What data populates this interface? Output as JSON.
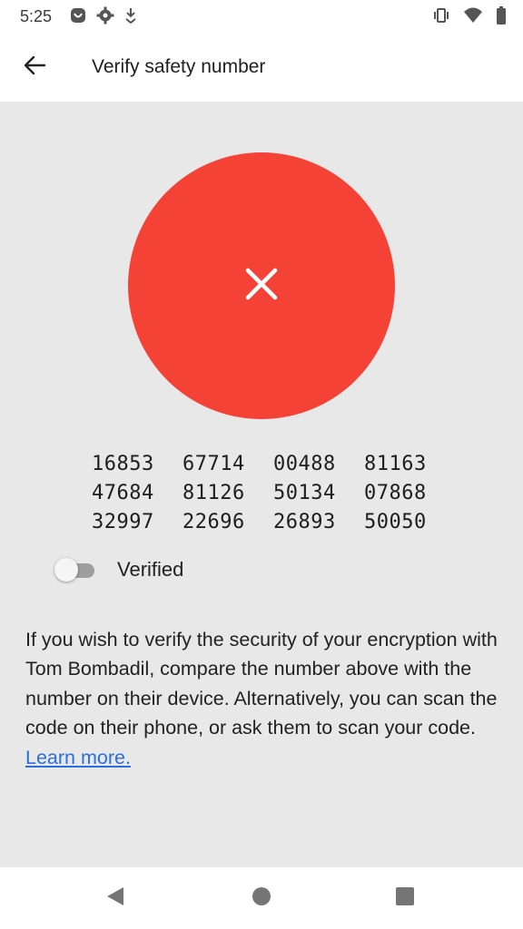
{
  "status_bar": {
    "time": "5:25",
    "left_icons": [
      "app-notification-icon",
      "gear-icon",
      "download-icon"
    ],
    "right_icons": [
      "vibrate-icon",
      "wifi-icon",
      "battery-icon"
    ]
  },
  "app_bar": {
    "back_icon": "arrow-left-icon",
    "title": "Verify safety number"
  },
  "verification": {
    "status_icon": "close-icon",
    "status_color": "#f44336",
    "number_rows": [
      [
        "16853",
        "67714",
        "00488",
        "81163"
      ],
      [
        "47684",
        "81126",
        "50134",
        "07868"
      ],
      [
        "32997",
        "22696",
        "26893",
        "50050"
      ]
    ],
    "verified_label": "Verified",
    "verified_toggle_on": false
  },
  "description": {
    "text": "If you wish to verify the security of your encryption with Tom Bombadil, compare the number above with the number on their device. Alternatively, you can scan the code on their phone, or ask them to scan your code. ",
    "link_text": "Learn more.",
    "link_color": "#2a6fdb"
  },
  "nav_bar": {
    "buttons": [
      "back-triangle-icon",
      "home-circle-icon",
      "recents-square-icon"
    ]
  }
}
